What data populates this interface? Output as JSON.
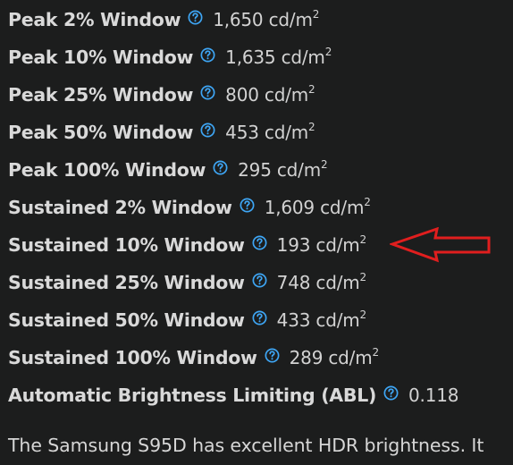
{
  "colors": {
    "background": "#1c1d1d",
    "text": "#d6d6d6",
    "help_icon": "#3ea6f5",
    "arrow": "#e01e1e"
  },
  "icons": {
    "help": "question-circle-icon",
    "annotation": "left-arrow-icon"
  },
  "measurements": [
    {
      "label": "Peak 2% Window",
      "value": "1,650 cd/m",
      "sup": "2"
    },
    {
      "label": "Peak 10% Window",
      "value": "1,635 cd/m",
      "sup": "2"
    },
    {
      "label": "Peak 25% Window",
      "value": "800 cd/m",
      "sup": "2"
    },
    {
      "label": "Peak 50% Window",
      "value": "453 cd/m",
      "sup": "2"
    },
    {
      "label": "Peak 100% Window",
      "value": "295 cd/m",
      "sup": "2"
    },
    {
      "label": "Sustained 2% Window",
      "value": "1,609 cd/m",
      "sup": "2"
    },
    {
      "label": "Sustained 10% Window",
      "value": "193 cd/m",
      "sup": "2"
    },
    {
      "label": "Sustained 25% Window",
      "value": "748 cd/m",
      "sup": "2"
    },
    {
      "label": "Sustained 50% Window",
      "value": "433 cd/m",
      "sup": "2"
    },
    {
      "label": "Sustained 100% Window",
      "value": "289 cd/m",
      "sup": "2"
    },
    {
      "label": "Automatic Brightness Limiting (ABL)",
      "value": "0.118",
      "sup": ""
    }
  ],
  "paragraph": "The Samsung S95D has excellent HDR brightness. It"
}
